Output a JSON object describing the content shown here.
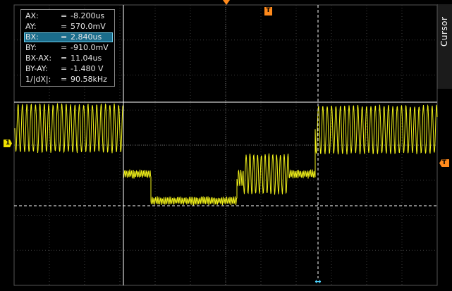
{
  "cursor_readout": {
    "rows": [
      {
        "label": "AX:",
        "eq": "=",
        "value": "-8.200us"
      },
      {
        "label": "AY:",
        "eq": "=",
        "value": "570.0mV"
      },
      {
        "label": "BX:",
        "eq": "=",
        "value": "2.840us"
      },
      {
        "label": "BY:",
        "eq": "=",
        "value": "-910.0mV"
      },
      {
        "label": "BX-AX:",
        "eq": "=",
        "value": "11.04us"
      },
      {
        "label": "BY-AY:",
        "eq": "=",
        "value": "-1.480 V"
      },
      {
        "label": "1/|dX|:",
        "eq": "=",
        "value": "90.58kHz"
      }
    ],
    "selected_index": 2
  },
  "side_menu": {
    "label": "Cursor"
  },
  "markers": {
    "channel1": "1",
    "trigger_top": "T",
    "trigger_level": "T"
  },
  "colors": {
    "trace": "#ffff1a",
    "grid": "#3d3d3d",
    "cursor": "#ffffff",
    "marker_orange": "#ff8a1c",
    "marker_yellow": "#f2e200",
    "highlight": "#1b6d8c"
  }
}
